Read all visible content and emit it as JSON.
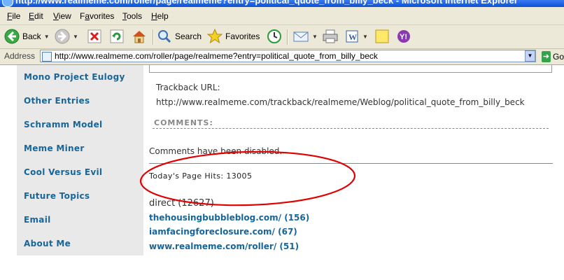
{
  "window": {
    "title": "http://www.realmeme.com/roller/page/realmeme?entry=political_quote_from_billy_beck - Microsoft Internet Explorer"
  },
  "menu": {
    "file": {
      "key": "F",
      "rest": "ile"
    },
    "edit": {
      "key": "E",
      "rest": "dit"
    },
    "view": {
      "key": "V",
      "rest": "iew"
    },
    "favorites": {
      "pre": "F",
      "key": "a",
      "rest": "vorites"
    },
    "tools": {
      "key": "T",
      "rest": "ools"
    },
    "help": {
      "key": "H",
      "rest": "elp"
    }
  },
  "toolbar": {
    "back_label": "Back",
    "search_label": "Search",
    "favorites_label": "Favorites"
  },
  "address": {
    "label": "Address",
    "url": "http://www.realmeme.com/roller/page/realmeme?entry=political_quote_from_billy_beck",
    "go_label": "Go"
  },
  "sidebar": {
    "items": [
      "Mono Project Eulogy",
      "Other Entries",
      "Schramm Model",
      "Meme Miner",
      "Cool Versus Evil",
      "Future Topics",
      "Email",
      "About Me"
    ]
  },
  "main": {
    "trackback_label": "Trackback URL:",
    "trackback_url": "http://www.realmeme.com/trackback/realmeme/Weblog/political_quote_from_billy_beck",
    "comments_header": "COMMENTS:",
    "comments_disabled": "Comments have been disabled.",
    "page_hits": "Today's Page Hits: 13005",
    "direct": "direct (12627)",
    "referrers": [
      "thehousingbubbleblog.com/ (156)",
      "iamfacingforeclosure.com/ (67)",
      "www.realmeme.com/roller/ (51)"
    ]
  },
  "colors": {
    "link": "#17669a",
    "annotation": "#e00000",
    "sidebar_bg": "#e9e9e9",
    "chrome": "#ece9d8"
  }
}
